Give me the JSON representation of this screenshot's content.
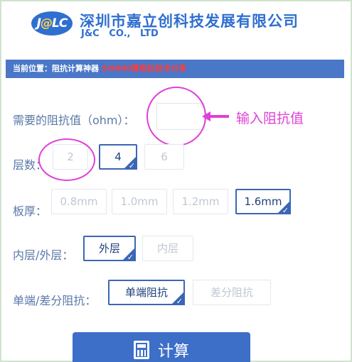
{
  "header": {
    "logo_text_1": "J",
    "logo_text_2": "@",
    "logo_text_3": "LC",
    "company_name": "深圳市嘉立创科技发展有限公司",
    "company_english": "J&C   CO.,   LTD"
  },
  "breadcrumb": {
    "prefix": "当前位置：阻抗计算神器",
    "link": "Si9000算阻抗技术分享"
  },
  "impedance": {
    "label": "需要的阻抗值（ohm）：",
    "value": "",
    "placeholder": ""
  },
  "annotation": {
    "text": "输入阻抗值"
  },
  "layers": {
    "label": "层数：",
    "options": [
      "2",
      "4",
      "6"
    ],
    "selected": "4"
  },
  "thickness": {
    "label": "板厚：",
    "options": [
      "0.8mm",
      "1.0mm",
      "1.2mm",
      "1.6mm"
    ],
    "selected": "1.6mm"
  },
  "layer_side": {
    "label": "内层/外层：",
    "options": [
      "外层",
      "内层"
    ],
    "selected": "外层"
  },
  "impedance_type": {
    "label": "单端/差分阻抗：",
    "options": [
      "单端阻抗",
      "差分阻抗"
    ],
    "selected": "单端阻抗"
  },
  "calculate": {
    "label": "计算",
    "icon": "calculator-icon"
  },
  "colors": {
    "brand_blue": "#2f6fd0",
    "bar_blue": "#4a77c7",
    "annotation_magenta": "#e040d8",
    "breadcrumb_link_red": "#ff3b3b"
  }
}
